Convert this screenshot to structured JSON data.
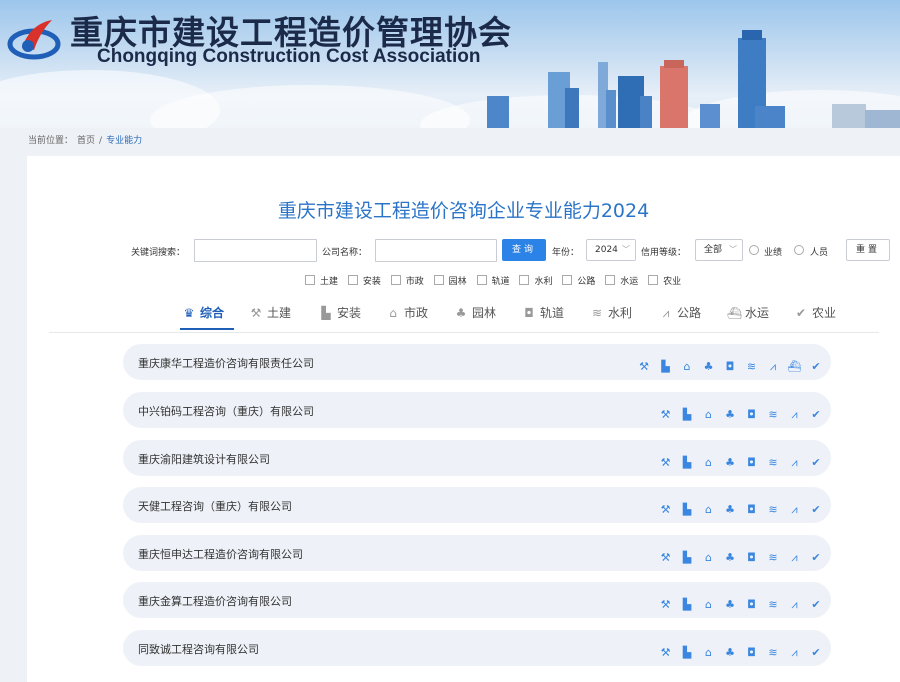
{
  "header": {
    "title_cn": "重庆市建设工程造价管理协会",
    "title_en": "Chongqing Construction Cost Association"
  },
  "breadcrumb": {
    "label": "当前位置：",
    "home": "首页",
    "sep": "/",
    "current": "专业能力"
  },
  "page_title": "重庆市建设工程造价咨询企业专业能力2024",
  "filters": {
    "keyword_label": "关键词搜索：",
    "keyword_value": "",
    "company_label": "公司名称：",
    "company_value": "",
    "query_button": "查询",
    "year_label": "年份：",
    "year_value": "2024",
    "credit_label": "信用等级：",
    "credit_value": "全部",
    "radio_performance": "业绩",
    "radio_personnel": "人员",
    "reset_button": "重置"
  },
  "checkboxes": [
    "土建",
    "安装",
    "市政",
    "园林",
    "轨道",
    "水利",
    "公路",
    "水运",
    "农业"
  ],
  "tabs": [
    {
      "label": "综合",
      "icon": "crown-icon"
    },
    {
      "label": "土建",
      "icon": "building-icon"
    },
    {
      "label": "安装",
      "icon": "install-icon"
    },
    {
      "label": "市政",
      "icon": "municipal-icon"
    },
    {
      "label": "园林",
      "icon": "garden-icon"
    },
    {
      "label": "轨道",
      "icon": "train-icon"
    },
    {
      "label": "水利",
      "icon": "water-conservancy-icon"
    },
    {
      "label": "公路",
      "icon": "road-icon"
    },
    {
      "label": "水运",
      "icon": "ship-icon"
    },
    {
      "label": "农业",
      "icon": "agriculture-icon"
    }
  ],
  "companies": [
    {
      "name": "重庆康华工程造价咨询有限责任公司"
    },
    {
      "name": "中兴铂码工程咨询（重庆）有限公司"
    },
    {
      "name": "重庆渝阳建筑设计有限公司"
    },
    {
      "name": "天健工程咨询（重庆）有限公司"
    },
    {
      "name": "重庆恒申达工程造价咨询有限公司"
    },
    {
      "name": "重庆金算工程造价咨询有限公司"
    },
    {
      "name": "同致诚工程咨询有限公司"
    }
  ],
  "colors": {
    "accent": "#2b83e8",
    "title_blue": "#2b74c8",
    "active_tab": "#1f5fb8",
    "row_bg": "#eef2f8"
  }
}
